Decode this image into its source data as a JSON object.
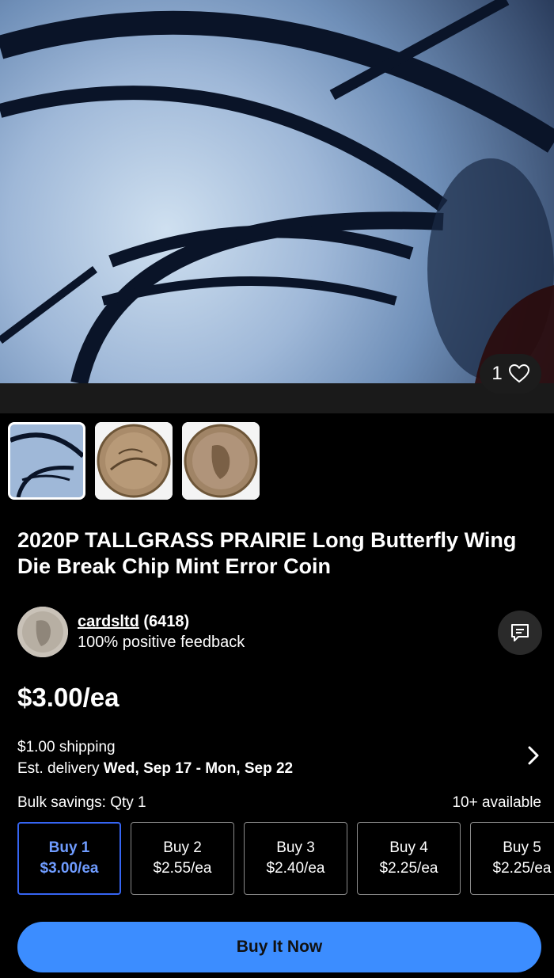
{
  "hero": {
    "favorite_count": "1",
    "icon": "heart-icon"
  },
  "thumbnails": [
    {
      "name": "thumbnail-butterfly-closeup",
      "selected": true
    },
    {
      "name": "thumbnail-coin-reverse",
      "selected": false
    },
    {
      "name": "thumbnail-coin-obverse",
      "selected": false
    }
  ],
  "listing": {
    "title": "2020P TALLGRASS PRAIRIE Long Butterfly Wing Die Break Chip Mint Error Coin"
  },
  "seller": {
    "name": "cardsltd",
    "rating": "(6418)",
    "feedback": "100% positive feedback"
  },
  "price": "$3.00/ea",
  "shipping": {
    "cost": "$1.00 shipping",
    "delivery_prefix": "Est. delivery ",
    "delivery_dates": "Wed, Sep 17 - Mon, Sep 22"
  },
  "bulk": {
    "label": "Bulk savings: Qty 1",
    "available": "10+ available",
    "tiers": [
      {
        "label": "Buy 1",
        "price": "$3.00/ea",
        "selected": true
      },
      {
        "label": "Buy 2",
        "price": "$2.55/ea",
        "selected": false
      },
      {
        "label": "Buy 3",
        "price": "$2.40/ea",
        "selected": false
      },
      {
        "label": "Buy 4",
        "price": "$2.25/ea",
        "selected": false
      },
      {
        "label": "Buy 5",
        "price": "$2.25/ea",
        "selected": false
      }
    ]
  },
  "cta": {
    "buy_now": "Buy It Now"
  },
  "colors": {
    "accent": "#3665f3",
    "buy_button": "#3c8dff",
    "background": "#000000"
  }
}
